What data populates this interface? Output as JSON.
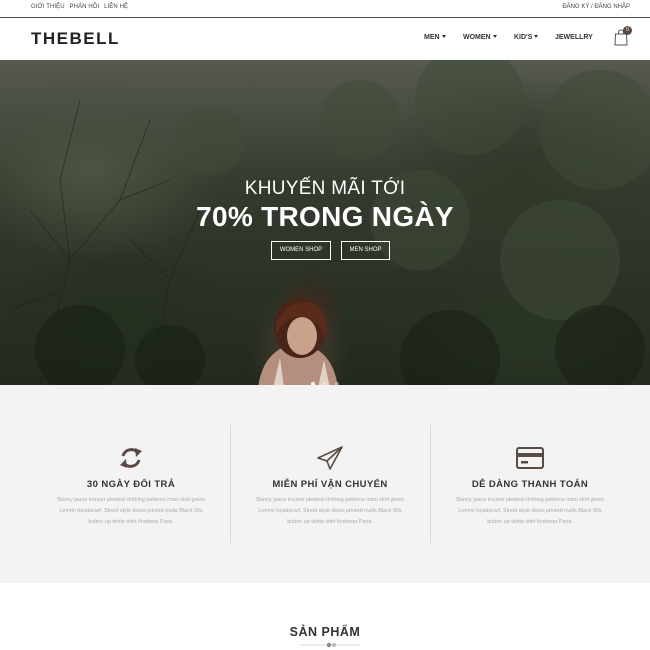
{
  "topbar": {
    "links": [
      "GIỚI THIỆU",
      "PHẢN HỒI",
      "LIÊN HỆ"
    ],
    "account": "ĐĂNG KÝ / ĐĂNG NHẬP"
  },
  "header": {
    "logo": "THEBELL",
    "nav": [
      "MEN",
      "WOMEN",
      "KID'S",
      "JEWELLRY"
    ],
    "cart_count": "0",
    "cart_icon": "shopping-bag-icon"
  },
  "hero": {
    "line1": "KHUYẾN MÃI TỚI",
    "line2": "70% TRONG NGÀY",
    "buttons": [
      "WOMEN SHOP",
      "MEN SHOP"
    ],
    "slides": 3,
    "active_slide": 1
  },
  "features": [
    {
      "icon": "refresh-icon",
      "title": "30 NGÀY ĐỔI TRẢ",
      "desc": "Skinny jeans trouser pleated clothing patterns maxi skirt green Lemrin headscarf. Street style dress printed malls Black 90s button up white shirt findwear Paris."
    },
    {
      "icon": "paper-plane-icon",
      "title": "MIỄN PHÍ VẬN CHUYỂN",
      "desc": "Skinny jeans trouser pleated clothing patterns maxi skirt green Lemrin headscarf. Street style dress printed malls Black 90s button up white shirt findwear Paris."
    },
    {
      "icon": "credit-card-icon",
      "title": "DỄ DÀNG THANH TOÁN",
      "desc": "Skinny jeans trouser pleated clothing patterns maxi skirt green Lemrin headscarf. Street style dress printed malls Black 90s button up white shirt findwear Paris."
    }
  ],
  "products": {
    "title": "SẢN PHẨM"
  },
  "colors": {
    "accent": "#5a4a44",
    "feature_bg": "#f3f3f3",
    "text_dark": "#333333",
    "text_muted": "#aaaaaa"
  }
}
